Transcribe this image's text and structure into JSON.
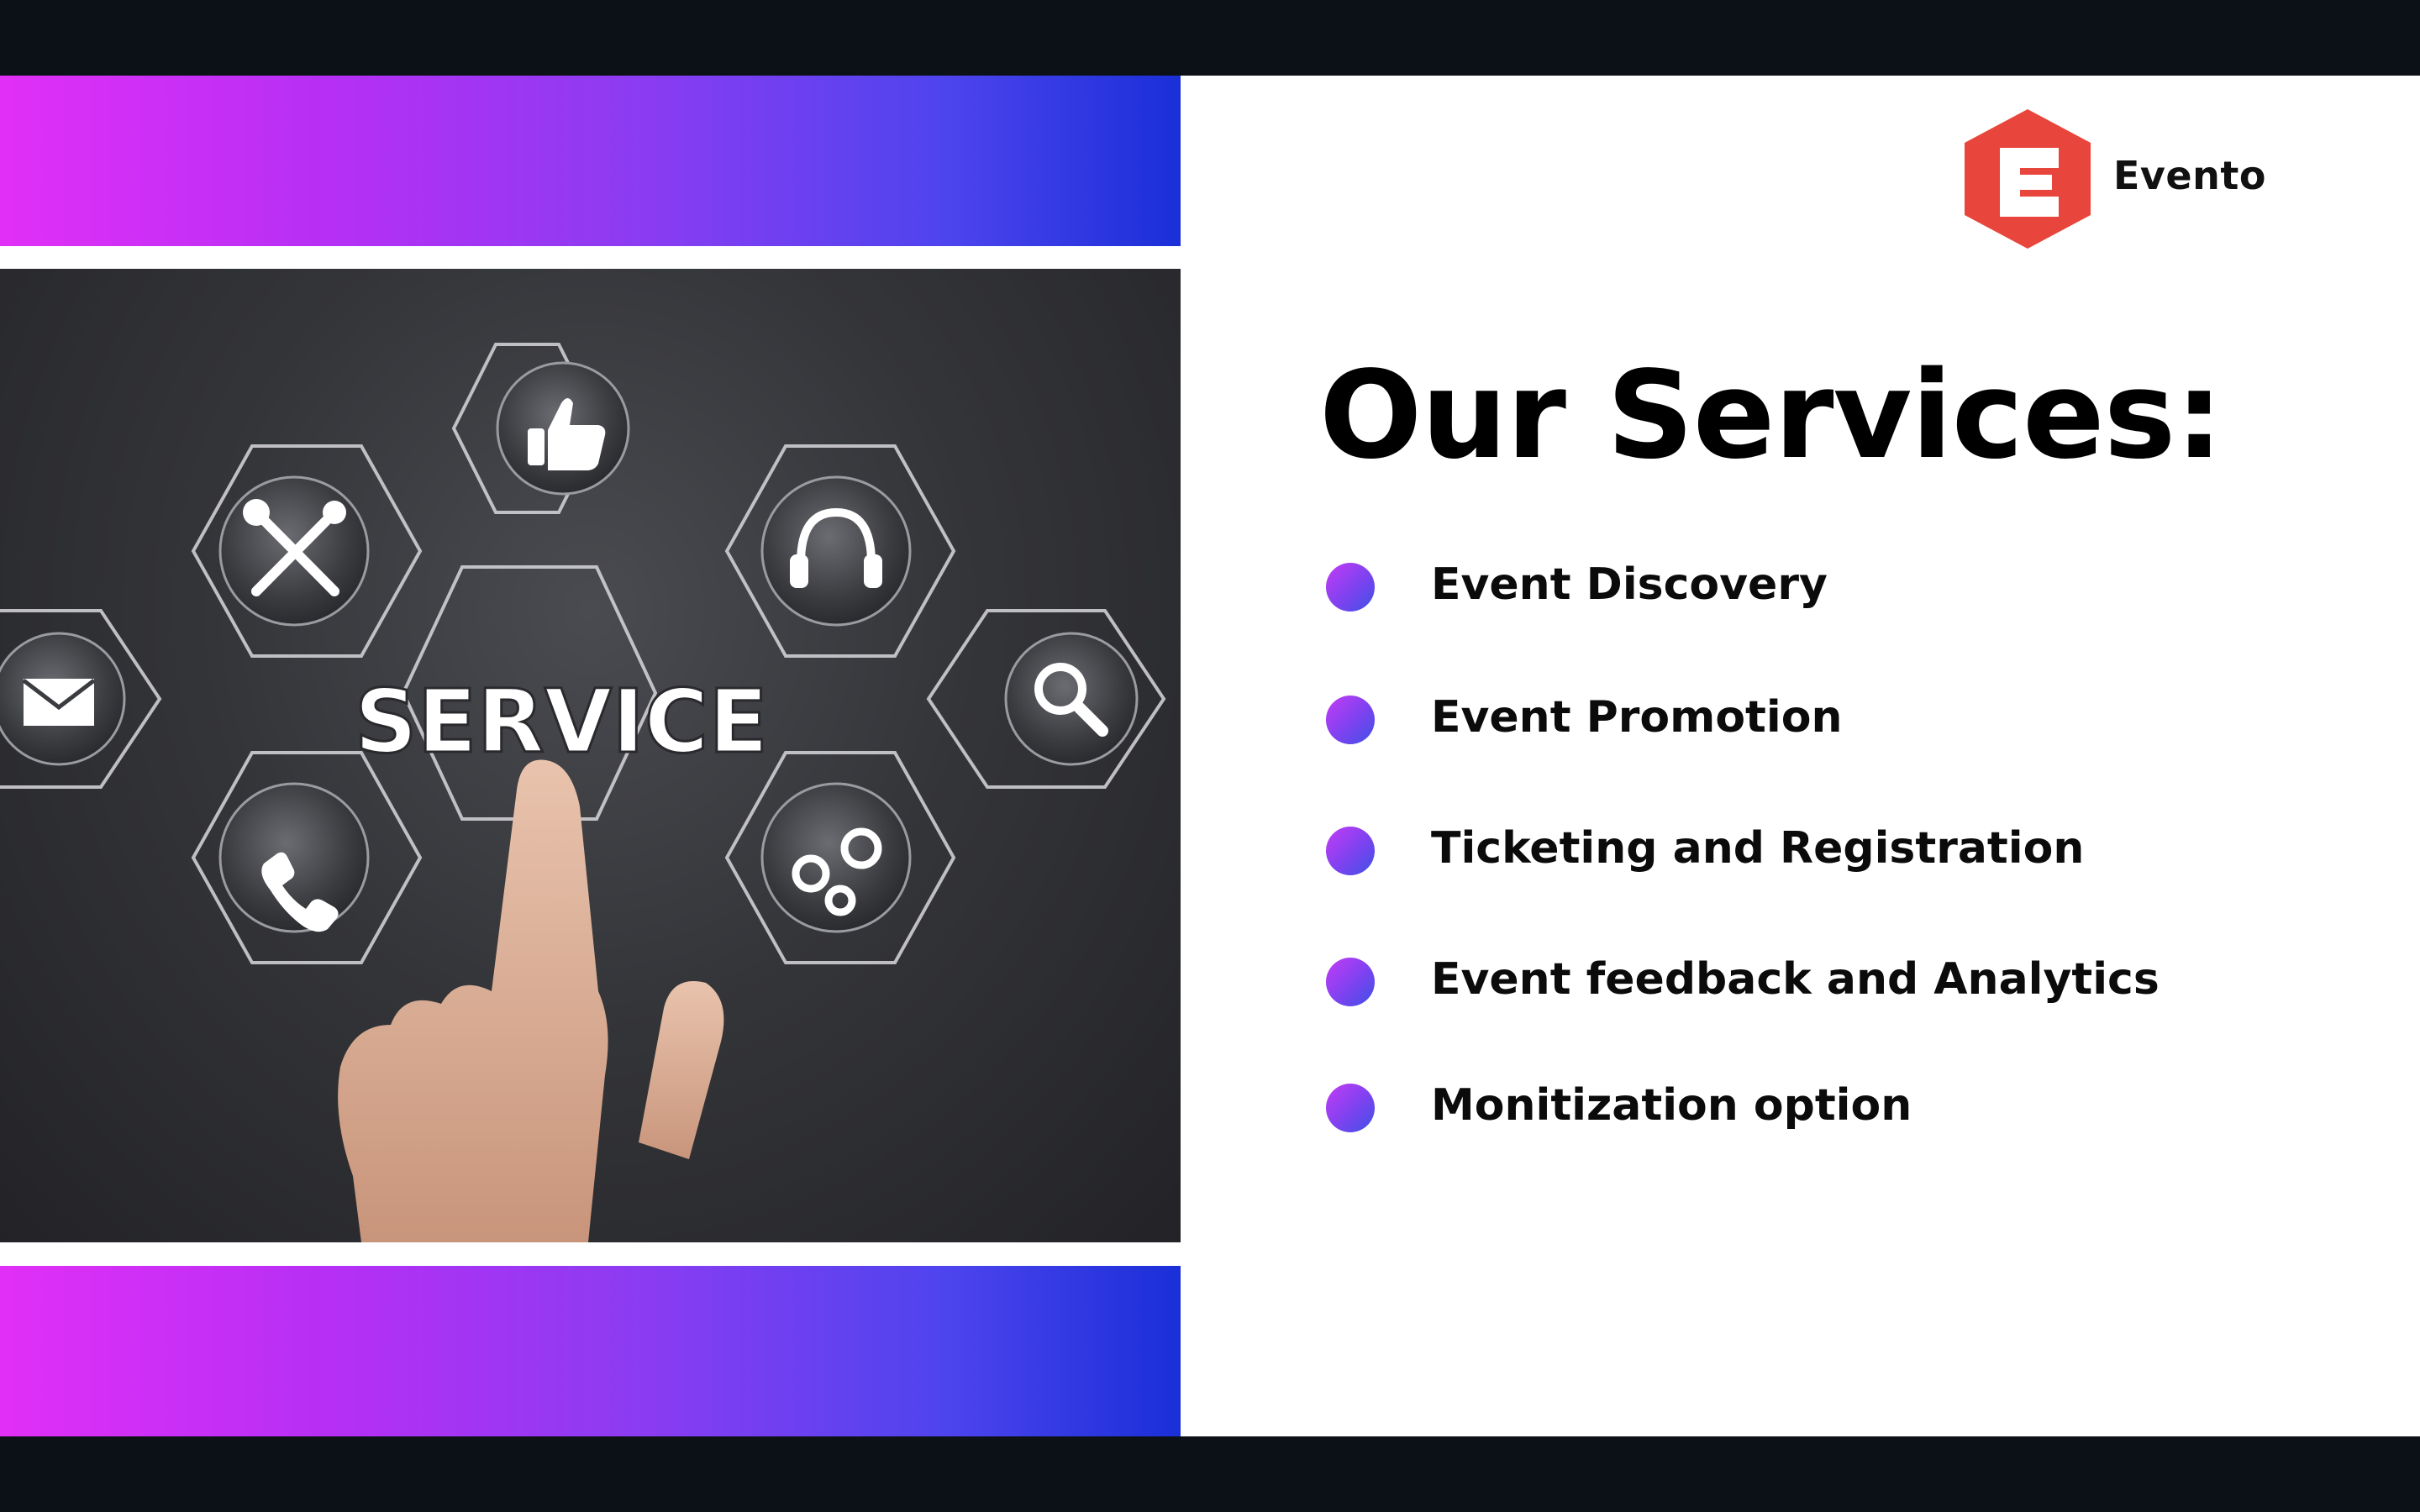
{
  "brand": {
    "name": "Evento",
    "logo_letter": "E",
    "logo_color": "#e8453c"
  },
  "heading": "Our Services:",
  "services": [
    {
      "label": "Event Discovery"
    },
    {
      "label": "Event Promotion"
    },
    {
      "label": "Ticketing and Registration"
    },
    {
      "label": "Event feedback and Analytics"
    },
    {
      "label": "Monitization option"
    }
  ],
  "photo": {
    "word": "SERVICE",
    "icons": [
      "thumbs-up-icon",
      "tools-icon",
      "headset-icon",
      "mail-icon",
      "search-icon",
      "phone-icon",
      "gears-icon"
    ]
  },
  "colors": {
    "band_start": "#e12ff7",
    "band_end": "#1a2fd8",
    "frame": "#0c1017"
  }
}
